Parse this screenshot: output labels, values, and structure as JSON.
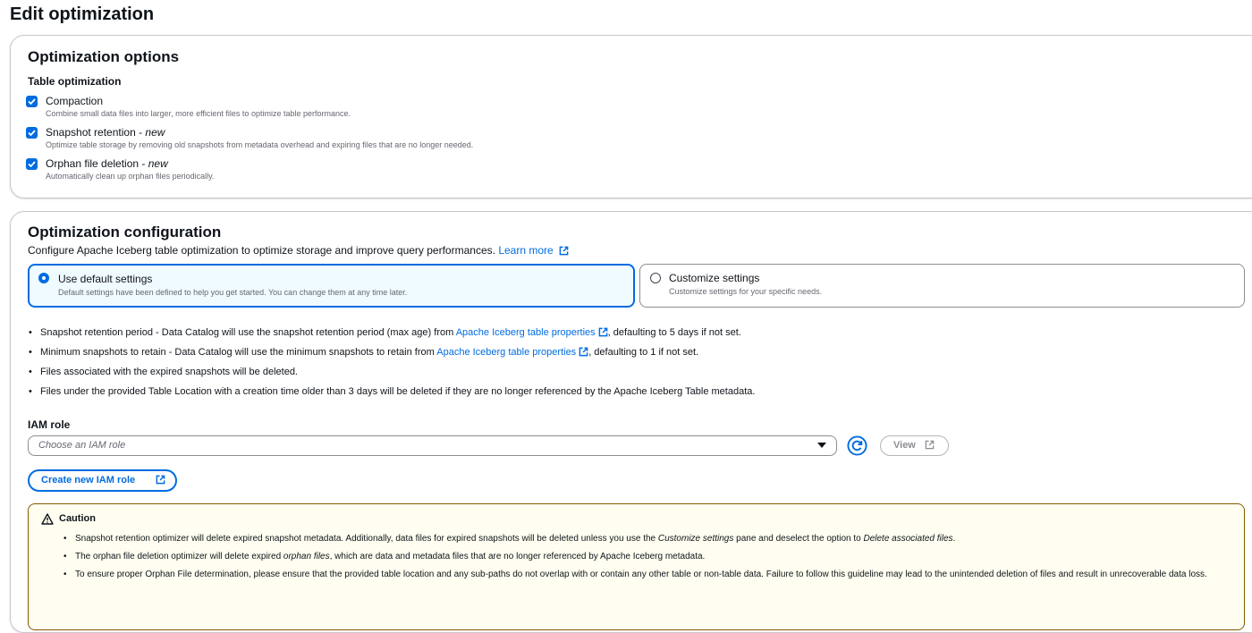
{
  "page": {
    "title": "Edit optimization"
  },
  "options_panel": {
    "heading": "Optimization options",
    "subheading": "Table optimization",
    "items": [
      {
        "label": "Compaction",
        "suffix": "",
        "desc": "Combine small data files into larger, more efficient files to optimize table performance.",
        "checked": true
      },
      {
        "label": "Snapshot retention - ",
        "suffix": "new",
        "desc": "Optimize table storage by removing old snapshots from metadata overhead and expiring files that are no longer needed.",
        "checked": true
      },
      {
        "label": "Orphan file deletion - ",
        "suffix": "new",
        "desc": "Automatically clean up orphan files periodically.",
        "checked": true
      }
    ]
  },
  "config_panel": {
    "heading": "Optimization configuration",
    "description": "Configure Apache Iceberg table optimization to optimize storage and improve query performances.",
    "learn_more": "Learn more",
    "tiles": [
      {
        "label": "Use default settings",
        "desc": "Default settings have been defined to help you get started. You can change them at any time later.",
        "selected": true
      },
      {
        "label": "Customize settings",
        "desc": "Customize settings for your specific needs.",
        "selected": false
      }
    ],
    "bullets": {
      "b1_pre": "Snapshot retention period - Data Catalog will use the snapshot retention period (max age) from ",
      "b1_link": "Apache Iceberg table properties",
      "b1_post": ", defaulting to 5 days if not set.",
      "b2_pre": "Minimum snapshots to retain - Data Catalog will use the minimum snapshots to retain from ",
      "b2_link": "Apache Iceberg table properties",
      "b2_post": ", defaulting to 1 if not set.",
      "b3": "Files associated with the expired snapshots will be deleted.",
      "b4": "Files under the provided Table Location with a creation time older than 3 days will be deleted if they are no longer referenced by the Apache Iceberg Table metadata."
    },
    "iam": {
      "label": "IAM role",
      "placeholder": "Choose an IAM role",
      "view_label": "View",
      "create_label": "Create new IAM role"
    },
    "caution": {
      "title": "Caution",
      "c1_a": "Snapshot retention optimizer will delete expired snapshot metadata. Additionally, data files for expired snapshots will be deleted unless you use the ",
      "c1_b": "Customize settings",
      "c1_c": " pane and deselect the option to ",
      "c1_d": "Delete associated files",
      "c1_e": ".",
      "c2_a": "The orphan file deletion optimizer will delete expired ",
      "c2_b": "orphan files",
      "c2_c": ", which are data and metadata files that are no longer referenced by Apache Iceberg metadata.",
      "c3": "To ensure proper Orphan File determination, please ensure that the provided table location and any sub-paths do not overlap with or contain any other table or non-table data. Failure to follow this guideline may lead to the unintended deletion of files and result in unrecoverable data loss."
    }
  },
  "colors": {
    "accent": "#006ce0",
    "warning_border": "#855900",
    "warning_bg": "#fffef0"
  },
  "icons": [
    "checkbox-checked-icon",
    "external-link-icon",
    "refresh-icon",
    "caret-down-icon",
    "warning-icon"
  ]
}
